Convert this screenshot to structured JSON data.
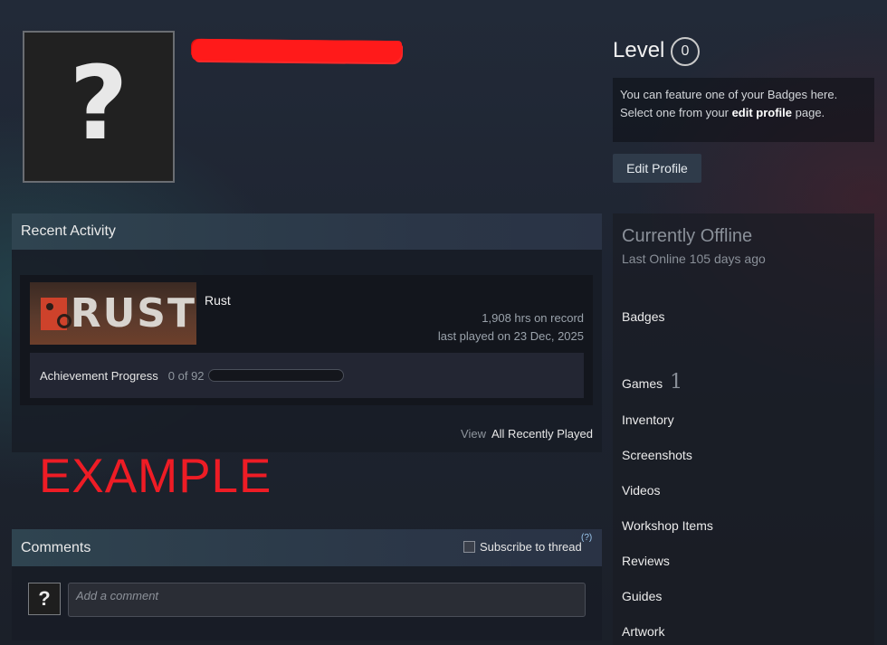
{
  "profile": {
    "avatar_glyph": "?",
    "level_label": "Level",
    "level_value": "0",
    "badge_text_1": "You can feature one of your Badges here.",
    "badge_text_2a": "Select one from your ",
    "badge_link": "edit profile",
    "badge_text_2b": " page.",
    "edit_profile_label": "Edit Profile",
    "redaction_color": "#ff1a1a"
  },
  "recent_activity": {
    "title": "Recent Activity",
    "game": {
      "logo_text": "RUST",
      "name": "Rust",
      "hours": "1,908 hrs on record",
      "last_played": "last played on 23 Dec, 2025",
      "achievement_label": "Achievement Progress",
      "achievement_count": "0 of 92",
      "achievement_progress": 0
    },
    "view_label": "View",
    "view_link": "All Recently Played"
  },
  "example_overlay": "EXAMPLE",
  "comments": {
    "title": "Comments",
    "subscribe_label": "Subscribe to thread",
    "help_glyph": "(?)",
    "avatar_glyph": "?",
    "placeholder": "Add a comment"
  },
  "status": {
    "state": "Currently Offline",
    "last_online": "Last Online 105 days ago"
  },
  "nav": {
    "badges": "Badges",
    "games": "Games",
    "games_count": "1",
    "inventory": "Inventory",
    "screenshots": "Screenshots",
    "videos": "Videos",
    "workshop": "Workshop Items",
    "reviews": "Reviews",
    "guides": "Guides",
    "artwork": "Artwork"
  },
  "colors": {
    "accent_red": "#ee1c25",
    "rust_brand": "#ce422b",
    "link_blue": "#9ac7ee"
  }
}
